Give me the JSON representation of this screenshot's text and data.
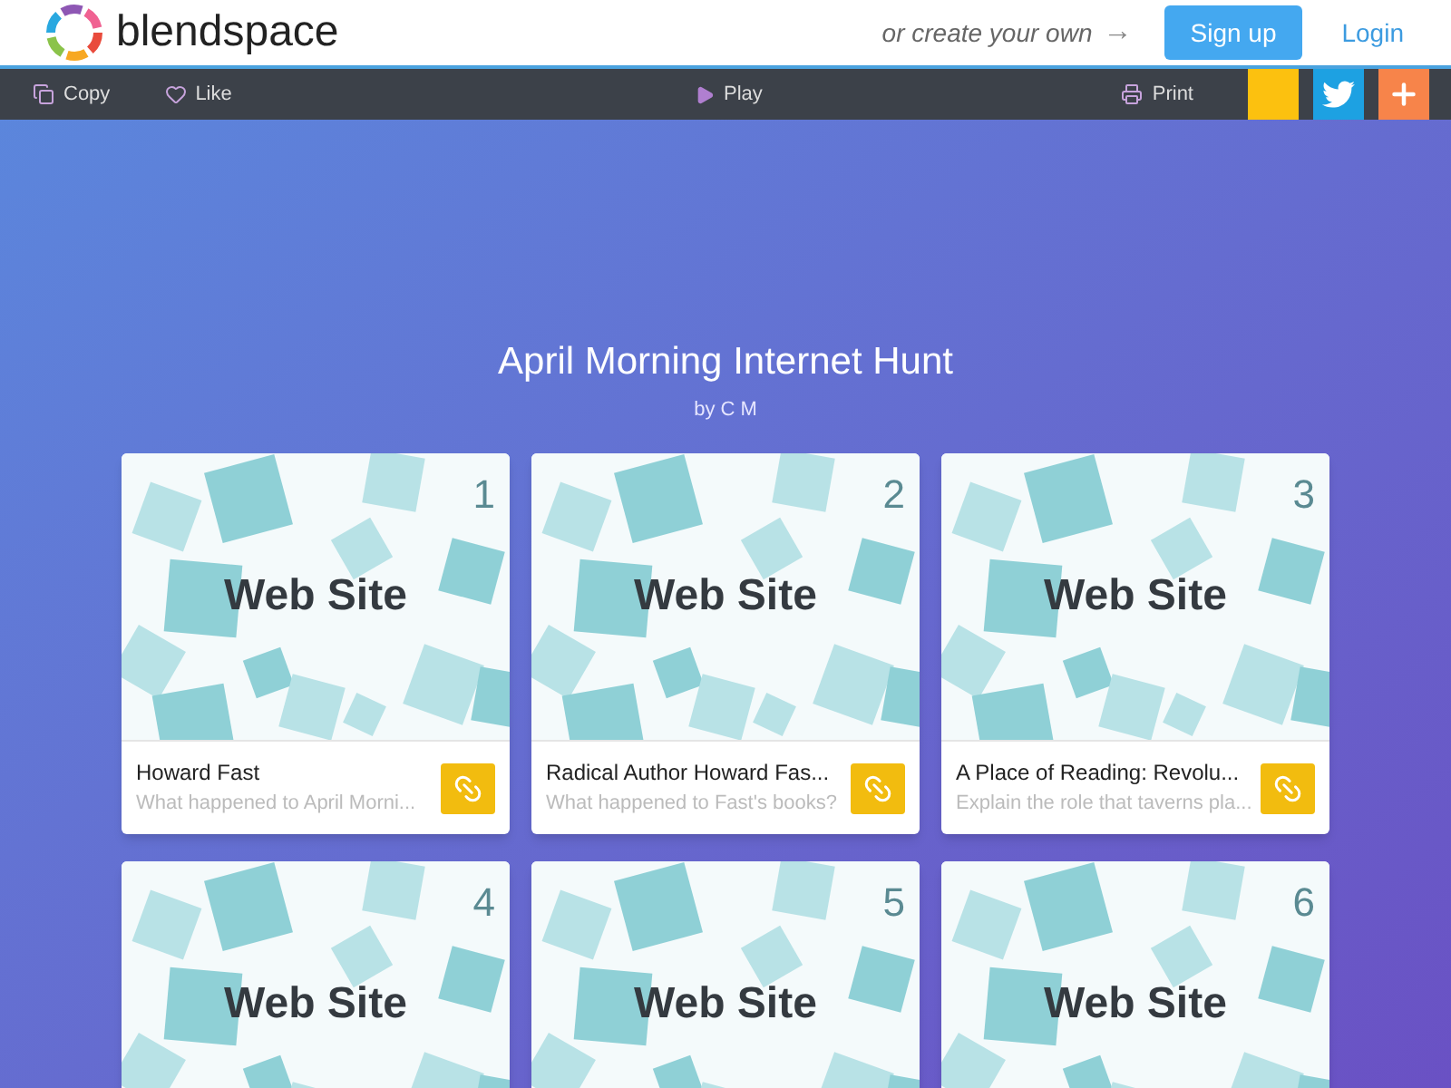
{
  "header": {
    "logo": "blendspace",
    "prompt": "or create your own",
    "arrow": "→",
    "signup": "Sign up",
    "login": "Login"
  },
  "toolbar": {
    "left": [
      {
        "kind": "copy",
        "label": "Copy"
      },
      {
        "kind": "like",
        "label": "Like"
      }
    ],
    "play": "Play",
    "print": "Print",
    "share": [
      {
        "kind": "blank",
        "color": "#fcc10f"
      },
      {
        "kind": "twitter",
        "color": "#1da1e2"
      },
      {
        "kind": "plus",
        "color": "#f7844a"
      }
    ]
  },
  "lesson": {
    "title": "April Morning Internet Hunt",
    "author": "by C M"
  },
  "cards": [
    {
      "number": "1",
      "thumb": "Web Site",
      "title": "Howard Fast",
      "description": "What happened to April Morni..."
    },
    {
      "number": "2",
      "thumb": "Web Site",
      "title": "Radical Author Howard Fas...",
      "description": "What happened to Fast's books?"
    },
    {
      "number": "3",
      "thumb": "Web Site",
      "title": "A Place of Reading: Revolu...",
      "description": "Explain the role that taverns pla..."
    },
    {
      "number": "4",
      "thumb": "Web Site"
    },
    {
      "number": "5",
      "thumb": "Web Site"
    },
    {
      "number": "6",
      "thumb": "Web Site"
    }
  ]
}
